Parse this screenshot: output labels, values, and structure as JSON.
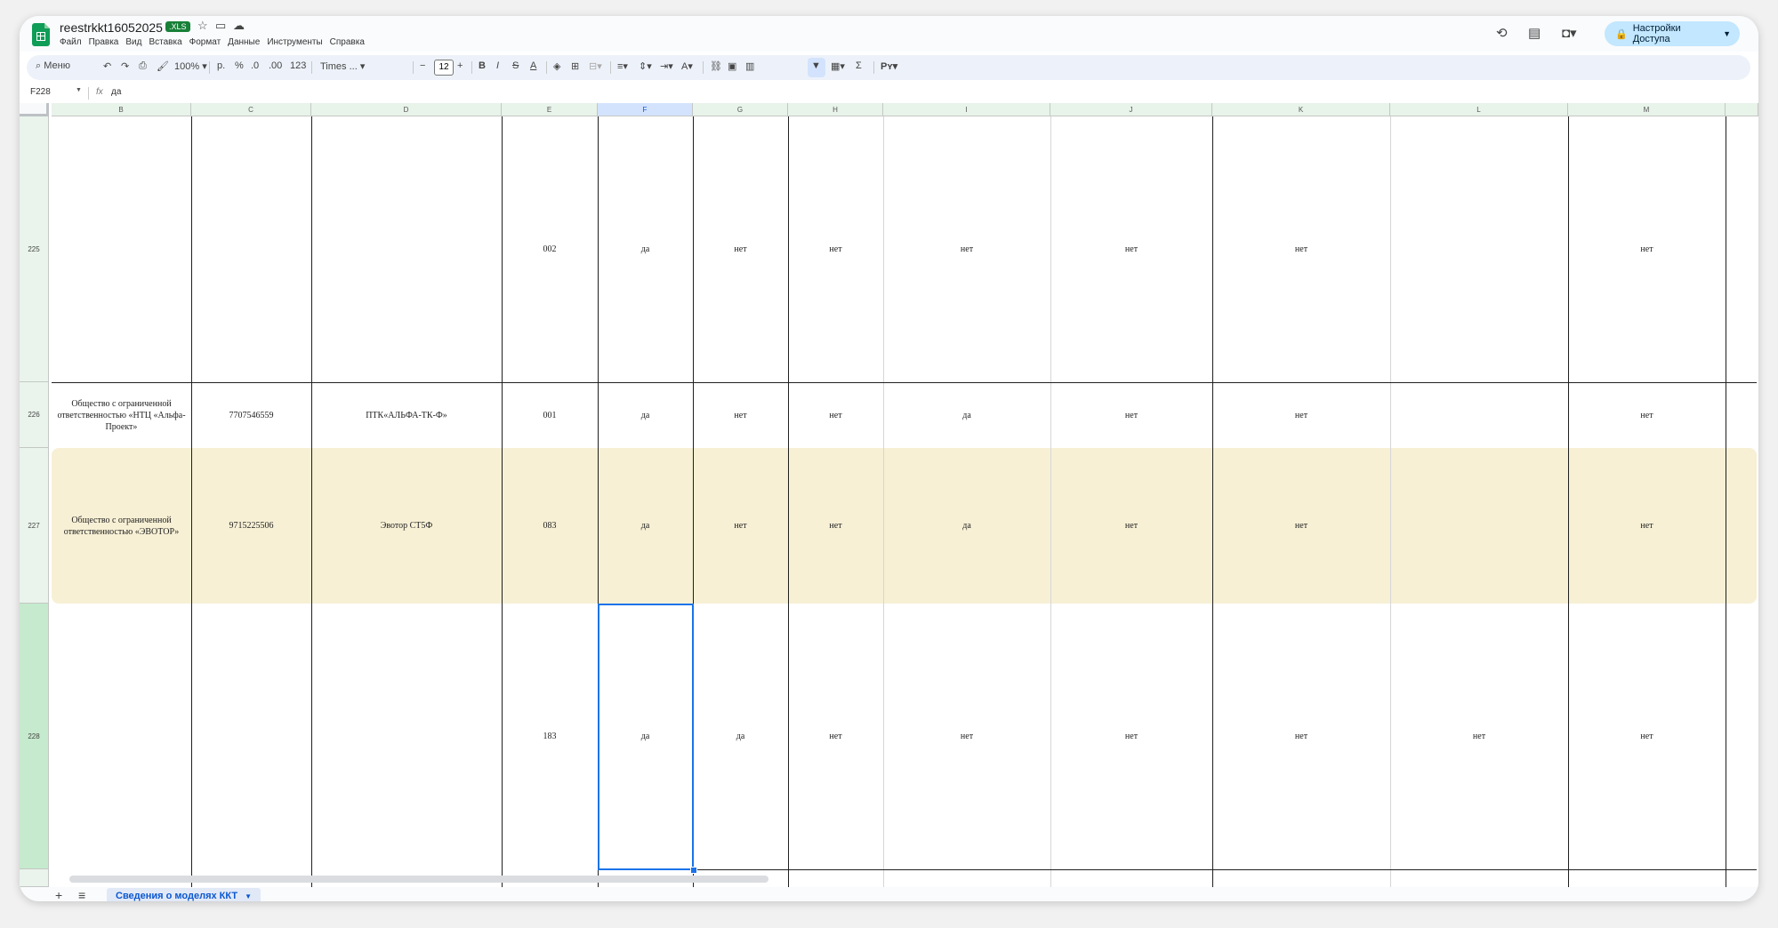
{
  "doc": {
    "title": "reestrkkt16052025",
    "badge": ".XLS",
    "menu": [
      "Файл",
      "Правка",
      "Вид",
      "Вставка",
      "Формат",
      "Данные",
      "Инструменты",
      "Справка"
    ],
    "share_label": "Настройки Доступа"
  },
  "toolbar": {
    "search_label": "Меню",
    "zoom": "100%",
    "currency": "р.",
    "percent": "%",
    "dec_decrease": ".0",
    "dec_increase": ".00",
    "number_format": "123",
    "font": "Times ...",
    "font_size": "12"
  },
  "formula_bar": {
    "cell_ref": "F228",
    "fx": "fx",
    "value": "да"
  },
  "columns": [
    "B",
    "C",
    "D",
    "E",
    "F",
    "G",
    "H",
    "I",
    "J",
    "K",
    "L",
    "M"
  ],
  "selected_column": "F",
  "rows": [
    {
      "num": "225",
      "cells": [
        "",
        "",
        "",
        "002",
        "да",
        "нет",
        "нет",
        "нет",
        "нет",
        "нет",
        "",
        "нет"
      ],
      "highlight": false
    },
    {
      "num": "226",
      "cells": [
        "Общество с ограниченной ответственностью «НТЦ «Альфа-Проект»",
        "7707546559",
        "ПТК«АЛЬФА-ТК-Ф»",
        "001",
        "да",
        "нет",
        "нет",
        "да",
        "нет",
        "нет",
        "",
        "нет"
      ],
      "highlight": false
    },
    {
      "num": "227",
      "cells": [
        "Общество с ограниченной ответственностью «ЭВОТОР»",
        "9715225506",
        "Эвотор СТ5Ф",
        "083",
        "да",
        "нет",
        "нет",
        "да",
        "нет",
        "нет",
        "",
        "нет"
      ],
      "highlight": true
    },
    {
      "num": "228",
      "cells": [
        "",
        "",
        "",
        "183",
        "да",
        "да",
        "нет",
        "нет",
        "нет",
        "нет",
        "нет",
        "нет"
      ],
      "highlight": false
    }
  ],
  "sheet_tab": {
    "label": "Сведения о моделях ККТ"
  },
  "colors": {
    "band": "#f7f0d5",
    "row_header": "#eaf4ec",
    "selection": "#1a73e8",
    "share_bg": "#c2e7ff",
    "logo": "#0f9d58"
  }
}
